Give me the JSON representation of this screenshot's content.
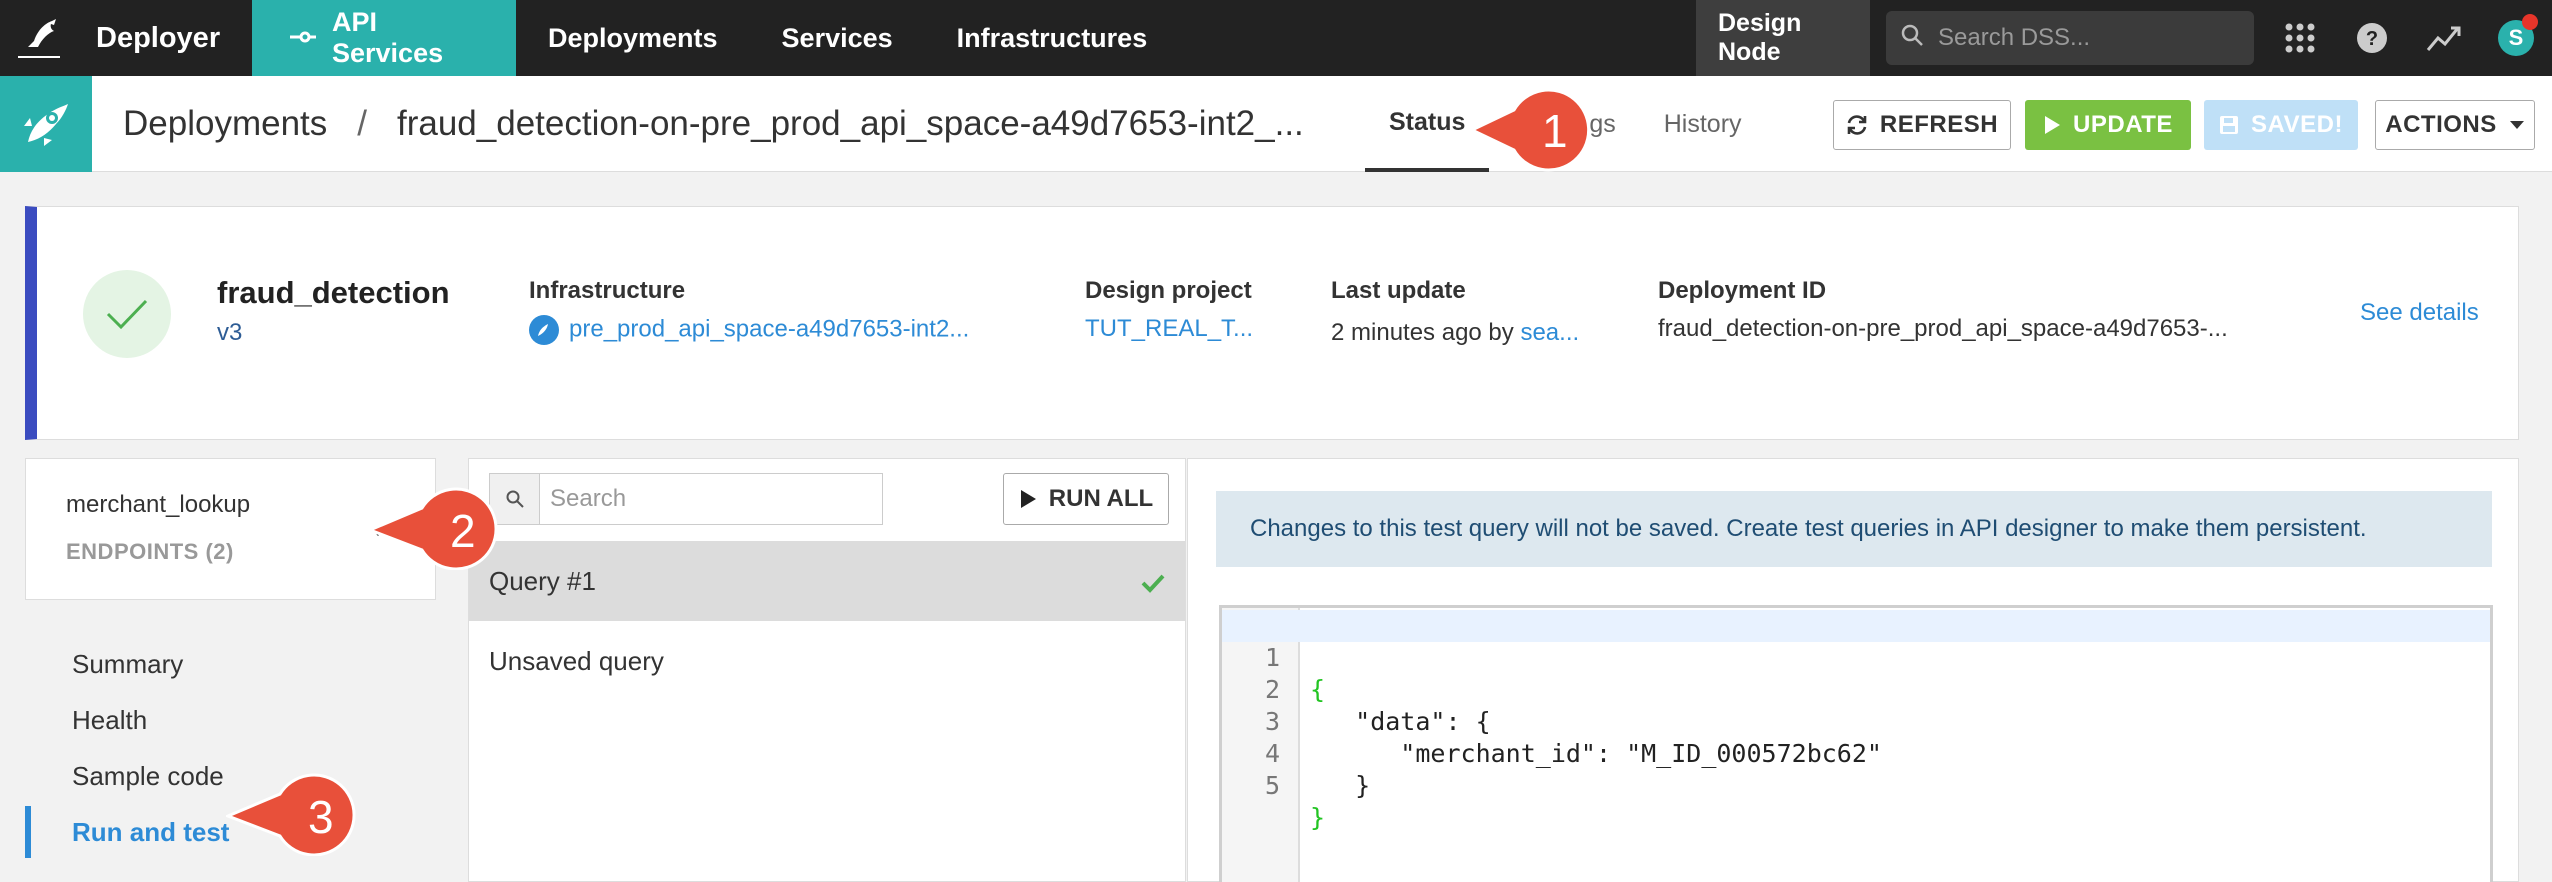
{
  "topnav": {
    "brand": "Deployer",
    "items": [
      {
        "label": "API Services",
        "active": true
      },
      {
        "label": "Deployments"
      },
      {
        "label": "Services"
      },
      {
        "label": "Infrastructures"
      }
    ],
    "design_node": "Design Node",
    "search_placeholder": "Search DSS...",
    "avatar_initial": "S"
  },
  "subbar": {
    "crumb_root": "Deployments",
    "crumb_sep": "/",
    "crumb_title": "fraud_detection-on-pre_prod_api_space-a49d7653-int2_...",
    "tabs": [
      {
        "label": "Status",
        "active": true
      },
      {
        "label": "Settings"
      },
      {
        "label": "History"
      }
    ],
    "refresh_label": "REFRESH",
    "update_label": "UPDATE",
    "saved_label": "SAVED!",
    "actions_label": "ACTIONS"
  },
  "card": {
    "name": "fraud_detection",
    "version": "v3",
    "infrastructure_label": "Infrastructure",
    "infrastructure_value": "pre_prod_api_space-a49d7653-int2...",
    "design_project_label": "Design project",
    "design_project_value": "TUT_REAL_T...",
    "last_update_label": "Last update",
    "last_update_text": "2 minutes ago by ",
    "last_update_user": "sea...",
    "deployment_id_label": "Deployment ID",
    "deployment_id_value": "fraud_detection-on-pre_prod_api_space-a49d7653-...",
    "see_details": "See details",
    "status_color": "#3b4cc0"
  },
  "endpoint": {
    "name": "merchant_lookup",
    "count_label": "ENDPOINTS (2)"
  },
  "leftnav": {
    "items": [
      {
        "label": "Summary"
      },
      {
        "label": "Health"
      },
      {
        "label": "Sample code"
      },
      {
        "label": "Run and test",
        "active": true
      }
    ]
  },
  "queries": {
    "search_placeholder": "Search",
    "run_all_label": "RUN ALL",
    "items": [
      {
        "label": "Query #1",
        "selected": true,
        "status": "success"
      },
      {
        "label": "Unsaved query"
      }
    ]
  },
  "detail": {
    "notice": "Changes to this test query will not be saved. Create test queries in API designer to make them persistent.",
    "code_lines": [
      {
        "num": "1",
        "text": "{"
      },
      {
        "num": "2",
        "text": "   \"data\": {"
      },
      {
        "num": "3",
        "text": "      \"merchant_id\": \"M_ID_000572bc62\""
      },
      {
        "num": "4",
        "text": "   }"
      },
      {
        "num": "5",
        "text": "}"
      }
    ]
  },
  "callouts": [
    "1",
    "2",
    "3"
  ],
  "colors": {
    "accent_teal": "#2ab1ac",
    "update_green": "#7ac142",
    "link_blue": "#2d8bd6",
    "callout_red": "#e8503a"
  }
}
